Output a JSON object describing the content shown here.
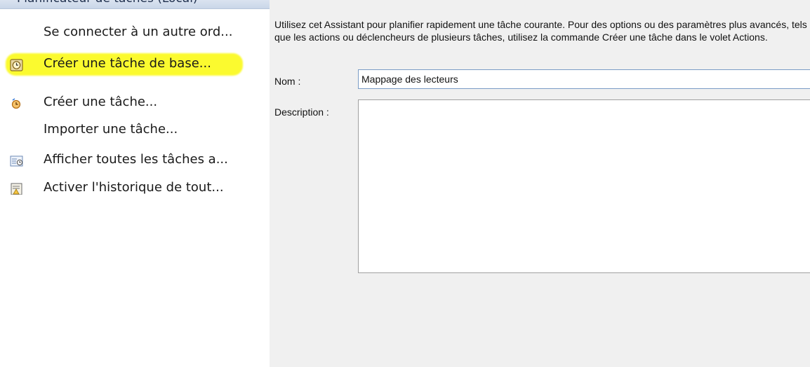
{
  "left_pane": {
    "header_title": "Planificateur de tâches (Local)",
    "actions": [
      {
        "label": "Se connecter à un autre ord...",
        "icon": "none"
      },
      {
        "label": "Créer une tâche de base...",
        "icon": "basic-task-clock-icon"
      },
      {
        "label": "Créer une tâche...",
        "icon": "task-clock-icon"
      },
      {
        "label": "Importer une tâche...",
        "icon": "none"
      },
      {
        "label": "Afficher toutes les tâches a...",
        "icon": "running-tasks-icon"
      },
      {
        "label": "Activer l'historique de tout...",
        "icon": "history-icon"
      }
    ],
    "highlight_color": "#fbfa2f"
  },
  "dialog": {
    "intro": "Utilisez cet Assistant pour planifier rapidement une tâche courante. Pour des options ou des paramètres plus avancés, tels que les actions ou déclencheurs de plusieurs tâches, utilisez la commande Créer une tâche dans le volet Actions.",
    "name_label": "Nom :",
    "name_value": "Mappage des lecteurs",
    "description_label": "Description :",
    "description_value": ""
  }
}
